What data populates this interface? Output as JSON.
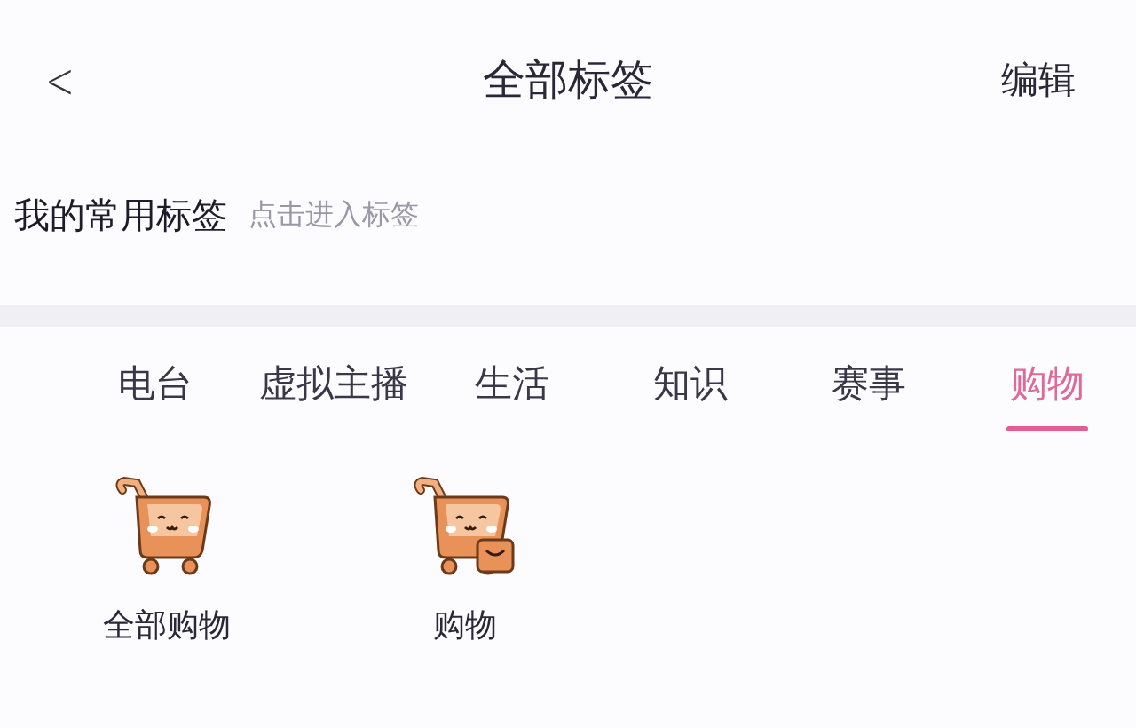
{
  "header": {
    "back": "<",
    "title": "全部标签",
    "action": "编辑"
  },
  "favorites": {
    "title": "我的常用标签",
    "hint": "点击进入标签"
  },
  "tabs": [
    {
      "label": "电台",
      "selected": false
    },
    {
      "label": "虚拟主播",
      "selected": false
    },
    {
      "label": "生活",
      "selected": false
    },
    {
      "label": "知识",
      "selected": false
    },
    {
      "label": "赛事",
      "selected": false
    },
    {
      "label": "购物",
      "selected": true
    }
  ],
  "items": [
    {
      "label": "全部购物",
      "kind": "cart"
    },
    {
      "label": "购物",
      "kind": "cart_bag"
    }
  ]
}
